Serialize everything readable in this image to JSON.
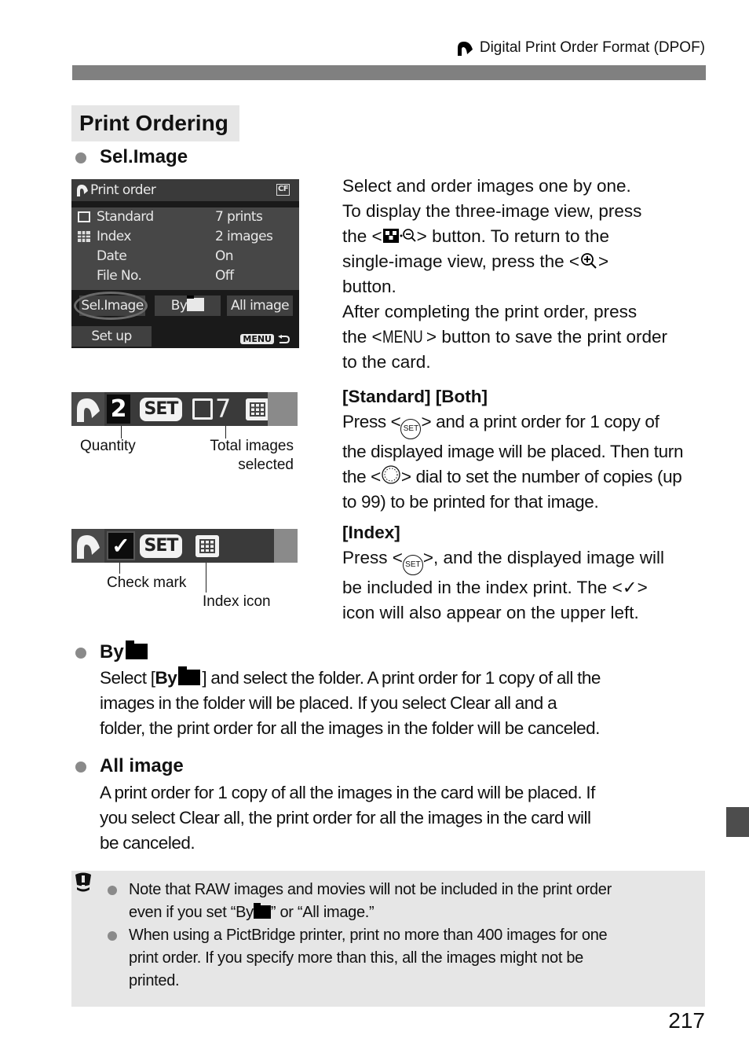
{
  "header": {
    "icon": "dpof-print-icon",
    "title": "Digital Print Order Format (DPOF)"
  },
  "section_title": "Print Ordering",
  "sel_image": {
    "heading": "Sel.Image",
    "lcd": {
      "title": "Print order",
      "card_icon": "CF",
      "rows": [
        {
          "icon": "standard-print-icon",
          "label": "Standard",
          "value": "7 prints"
        },
        {
          "icon": "index-print-icon",
          "label": "Index",
          "value": "2 images"
        },
        {
          "icon": "",
          "label": "Date",
          "value": "On"
        },
        {
          "icon": "",
          "label": "File No.",
          "value": "Off"
        }
      ],
      "buttons": {
        "sel_image": "Sel.Image",
        "by_folder": "By",
        "all_image": "All image",
        "set_up": "Set up"
      },
      "menu_label": "MENU"
    },
    "desc": {
      "l1": "Select and order images one by one.",
      "l2": "To display the three-image view, press",
      "l3a": "the <",
      "l3b": "> button. To return to the",
      "l4a": "single-image view, press the <",
      "l4b": ">",
      "l5": "button.",
      "l6": "After completing the print order, press",
      "l7a": "the <",
      "l7menu": "MENU",
      "l7b": "> button to save the print order",
      "l8": "to the card."
    }
  },
  "standard_strip": {
    "quantity": "2",
    "set_label": "SET",
    "total": "7",
    "callout_quantity": "Quantity",
    "callout_total_l1": "Total images",
    "callout_total_l2": "selected"
  },
  "standard_desc": {
    "heading": "[Standard] [Both]",
    "l1a": "Press <",
    "l1b": "> and a print order for 1 copy of",
    "l2": "the displayed image will be placed. Then turn",
    "l3a": "the <",
    "l3b": "> dial to set the number of copies (up",
    "l4": "to 99) to be printed for that image.",
    "set_glyph": "SET"
  },
  "index_strip": {
    "check": "✓",
    "set_label": "SET",
    "callout_check": "Check mark",
    "callout_index": "Index icon"
  },
  "index_desc": {
    "heading": "[Index]",
    "l1a": "Press <",
    "l1b": ">, and the displayed image will",
    "l2a": "be included in the index print. The <",
    "l2check": "✓",
    "l2b": ">",
    "l3": "icon will also appear on the upper left.",
    "set_glyph": "SET"
  },
  "by_folder": {
    "heading": "By",
    "l1a": "Select [",
    "l1bold": "By",
    "l1b": "] and select the folder. A print order for 1 copy of all the",
    "l2": "images in the folder will be placed. If you select Clear all and a",
    "l3": "folder, the print order for all the images in the folder will be canceled."
  },
  "all_image": {
    "heading": "All image",
    "l1": "A print order for 1 copy of all the images in the card will be placed. If",
    "l2": "you select Clear all, the print order for all the images in the card will",
    "l3": "be canceled."
  },
  "caution": {
    "icon": "caution-icon",
    "item1_l1": "Note that RAW images and movies will not be included in the print order",
    "item1_l2a": "even if you set “By",
    "item1_l2b": "” or “All image.”",
    "item2_l1": "When using a PictBridge printer, print no more than 400 images for one",
    "item2_l2": "print order. If you specify more than this, all the images might not be",
    "item2_l3": "printed."
  },
  "page_number": "217"
}
